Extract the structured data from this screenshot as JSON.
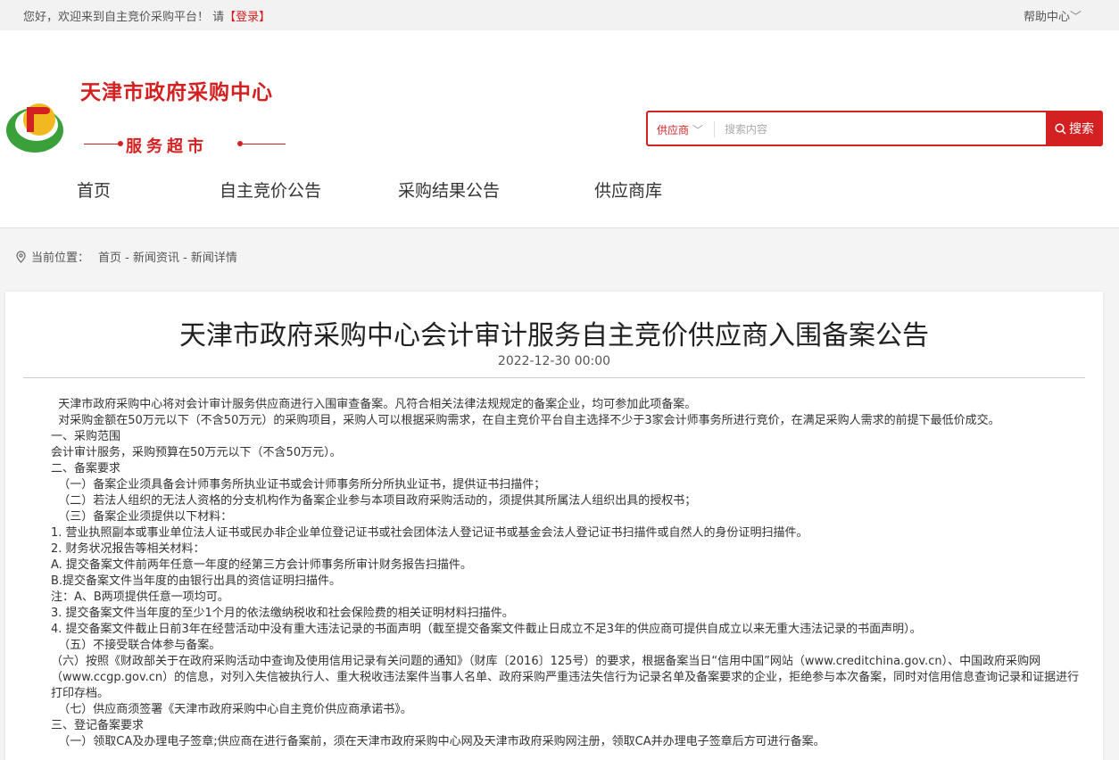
{
  "topbar": {
    "greeting": "您好，欢迎来到自主竞价采购平台！ 请",
    "login": "【登录】",
    "help": "帮助中心"
  },
  "brand": {
    "title": "天津市政府采购中心",
    "subtitle": "服务超市",
    "accent_color": "#d32121"
  },
  "search": {
    "type": "供应商",
    "placeholder": "搜索内容",
    "button": "搜索"
  },
  "nav": [
    "首页",
    "自主竞价公告",
    "采购结果公告",
    "供应商库"
  ],
  "breadcrumb": {
    "label": "当前位置：",
    "path": "首页 - 新闻资讯 - 新闻详情"
  },
  "article": {
    "title": "天津市政府采购中心会计审计服务自主竞价供应商入围备案公告",
    "date": "2022-12-30 00:00",
    "paragraphs": [
      "  天津市政府采购中心将对会计审计服务供应商进行入围审查备案。凡符合相关法律法规规定的备案企业，均可参加此项备案。",
      "  对采购金额在50万元以下（不含50万元）的采购项目，采购人可以根据采购需求，在自主竞价平台自主选择不少于3家会计师事务所进行竞价，在满足采购人需求的前提下最低价成交。",
      "一、采购范围",
      "会计审计服务，采购预算在50万元以下（不含50万元）。",
      "二、备案要求",
      "  （一）备案企业须具备会计师事务所执业证书或会计师事务所分所执业证书，提供证书扫描件；",
      "  （二）若法人组织的无法人资格的分支机构作为备案企业参与本项目政府采购活动的，须提供其所属法人组织出具的授权书；",
      "  （三）备案企业须提供以下材料：",
      "1. 营业执照副本或事业单位法人证书或民办非企业单位登记证书或社会团体法人登记证书或基金会法人登记证书扫描件或自然人的身份证明扫描件。",
      "2. 财务状况报告等相关材料：",
      "A. 提交备案文件前两年任意一年度的经第三方会计师事务所审计财务报告扫描件。",
      "B.提交备案文件当年度的由银行出具的资信证明扫描件。",
      "注：A、B两项提供任意一项均可。",
      "3. 提交备案文件当年度的至少1个月的依法缴纳税收和社会保险费的相关证明材料扫描件。",
      "4. 提交备案文件截止日前3年在经营活动中没有重大违法记录的书面声明（截至提交备案文件截止日成立不足3年的供应商可提供自成立以来无重大违法记录的书面声明）。",
      "  （五）不接受联合体参与备案。",
      "  （六）按照《财政部关于在政府采购活动中查询及使用信用记录有关问题的通知》（财库〔2016〕125号）的要求，根据备案当日“信用中国”网站（www.creditchina.gov.cn）、中国政府采购网（www.ccgp.gov.cn）的信息，对列入失信被执行人、重大税收违法案件当事人名单、政府采购严重违法失信行为记录名单及备案要求的企业，拒绝参与本次备案，同时对信用信息查询记录和证据进行打印存档。",
      "  （七）供应商须签署《天津市政府采购中心自主竞价供应商承诺书》。",
      "三、登记备案要求",
      "  （一）领取CA及办理电子签章;供应商在进行备案前，须在天津市政府采购中心网及天津市政府采购网注册，领取CA并办理电子签章后方可进行备案。"
    ]
  }
}
